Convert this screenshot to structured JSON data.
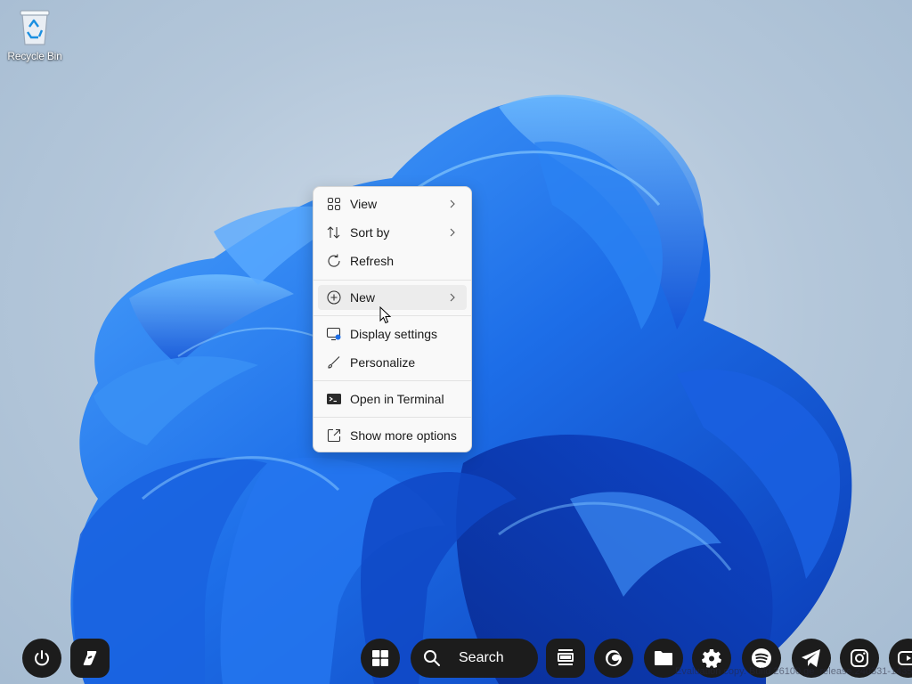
{
  "desktop": {
    "icons": [
      {
        "label": "Recycle Bin",
        "icon": "recycle-bin-icon"
      }
    ]
  },
  "context_menu": {
    "items": [
      {
        "label": "View",
        "icon": "grid-view-icon",
        "submenu": true
      },
      {
        "label": "Sort by",
        "icon": "sort-arrows-icon",
        "submenu": true
      },
      {
        "label": "Refresh",
        "icon": "refresh-icon",
        "submenu": false
      },
      {
        "label": "New",
        "icon": "plus-circle-icon",
        "submenu": true,
        "hovered": true
      },
      {
        "label": "Display settings",
        "icon": "display-settings-icon",
        "submenu": false
      },
      {
        "label": "Personalize",
        "icon": "brush-icon",
        "submenu": false
      },
      {
        "label": "Open in Terminal",
        "icon": "terminal-icon",
        "submenu": false
      },
      {
        "label": "Show more options",
        "icon": "share-expand-icon",
        "submenu": false
      }
    ]
  },
  "taskbar": {
    "left": [
      {
        "name": "power",
        "icon": "power-icon"
      },
      {
        "name": "app",
        "icon": "app-logo-icon"
      }
    ],
    "center": [
      {
        "name": "start",
        "icon": "windows-start-icon"
      },
      {
        "name": "search",
        "icon": "search-icon",
        "label": "Search"
      },
      {
        "name": "task-view",
        "icon": "task-view-icon"
      },
      {
        "name": "edge",
        "icon": "edge-icon"
      },
      {
        "name": "file-explorer",
        "icon": "folder-icon"
      },
      {
        "name": "settings",
        "icon": "gear-icon"
      },
      {
        "name": "spotify",
        "icon": "spotify-icon"
      },
      {
        "name": "telegram",
        "icon": "telegram-icon"
      },
      {
        "name": "instagram",
        "icon": "instagram-icon"
      },
      {
        "name": "youtube",
        "icon": "youtube-icon"
      }
    ],
    "watermark": "Evaluation copy. Build 26100.ge_release.240331-1435"
  },
  "colors": {
    "menu_bg": "#f9f9f9",
    "menu_hover": "#ececec",
    "taskbar_button": "#1c1c1c",
    "bloom_blue": "#1f6fe6"
  }
}
